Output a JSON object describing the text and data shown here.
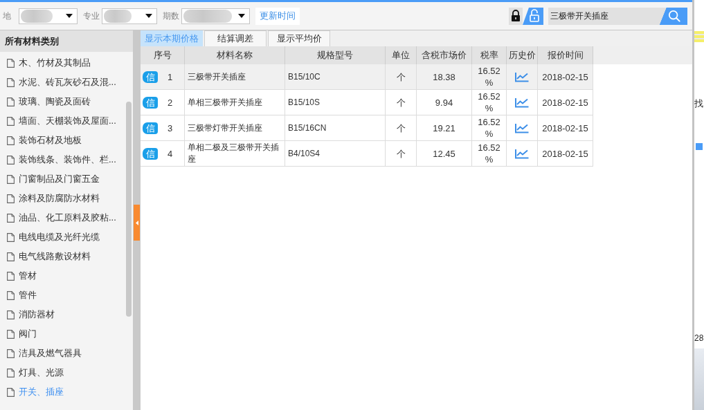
{
  "filters": [
    {
      "label": "地"
    },
    {
      "label": "专业"
    },
    {
      "label": "期数"
    }
  ],
  "update_button": {
    "label": "更新时间"
  },
  "lock_toggle": {
    "locked": false
  },
  "search": {
    "value": "三极带开关插座"
  },
  "sidebar": {
    "title": "所有材料类别",
    "items": [
      {
        "label": "木、竹材及其制品",
        "selected": false
      },
      {
        "label": "水泥、砖瓦灰砂石及混...",
        "selected": false
      },
      {
        "label": "玻璃、陶瓷及面砖",
        "selected": false
      },
      {
        "label": "墙面、天棚装饰及屋面...",
        "selected": false
      },
      {
        "label": "装饰石材及地板",
        "selected": false
      },
      {
        "label": "装饰线条、装饰件、栏...",
        "selected": false
      },
      {
        "label": "门窗制品及门窗五金",
        "selected": false
      },
      {
        "label": "涂料及防腐防水材料",
        "selected": false
      },
      {
        "label": "油品、化工原料及胶粘...",
        "selected": false
      },
      {
        "label": "电线电缆及光纤光缆",
        "selected": false
      },
      {
        "label": "电气线路敷设材料",
        "selected": false
      },
      {
        "label": "管材",
        "selected": false
      },
      {
        "label": "管件",
        "selected": false
      },
      {
        "label": "消防器材",
        "selected": false
      },
      {
        "label": "阀门",
        "selected": false
      },
      {
        "label": "洁具及燃气器具",
        "selected": false
      },
      {
        "label": "灯具、光源",
        "selected": false
      },
      {
        "label": "开关、插座",
        "selected": true
      }
    ]
  },
  "tabs": [
    {
      "label": "显示本期价格",
      "selected": true
    },
    {
      "label": "结算调差",
      "selected": false
    },
    {
      "label": "显示平均价",
      "selected": false
    }
  ],
  "table": {
    "columns": [
      "序号",
      "材料名称",
      "规格型号",
      "单位",
      "含税市场价",
      "税率",
      "历史价",
      "报价时间"
    ],
    "rows": [
      {
        "selected": true,
        "badge": "信",
        "index": "1",
        "name": "三极带开关插座",
        "spec": "B15/10C",
        "unit": "个",
        "price": "18.38",
        "tax_rate": "16.52%",
        "date": "2018-02-15"
      },
      {
        "selected": false,
        "badge": "信",
        "index": "2",
        "name": "单相三极带开关插座",
        "spec": "B15/10S",
        "unit": "个",
        "price": "9.94",
        "tax_rate": "16.52%",
        "date": "2018-02-15"
      },
      {
        "selected": false,
        "badge": "信",
        "index": "3",
        "name": "三极带灯带开关插座",
        "spec": "B15/16CN",
        "unit": "个",
        "price": "19.21",
        "tax_rate": "16.52%",
        "date": "2018-02-15"
      },
      {
        "selected": false,
        "badge": "信",
        "index": "4",
        "name": "单相二极及三极带开关插座",
        "spec": "B4/10S4",
        "unit": "个",
        "price": "12.45",
        "tax_rate": "16.52%",
        "date": "2018-02-15"
      }
    ]
  },
  "background_window": {
    "texts": [
      "找",
      "28"
    ]
  }
}
